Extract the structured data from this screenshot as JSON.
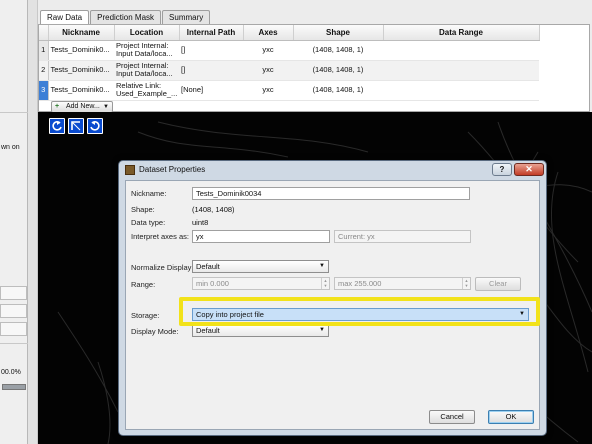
{
  "left_panel": {
    "fragment_text": "wn on",
    "progress_text": "00.0%",
    "progress_fraction": 1.0
  },
  "tabs": [
    {
      "label": "Raw Data",
      "active": true
    },
    {
      "label": "Prediction Mask",
      "active": false
    },
    {
      "label": "Summary",
      "active": false
    }
  ],
  "table": {
    "columns": [
      "",
      "Nickname",
      "Location",
      "Internal Path",
      "Axes",
      "Shape",
      "Data Range"
    ],
    "rows": [
      {
        "num": "1",
        "nickname": "Tests_Dominik0...",
        "location": "Project Internal: Input Data/loca...",
        "internal_path": "[]",
        "axes": "yxc",
        "shape": "(1408, 1408, 1)",
        "data_range": ""
      },
      {
        "num": "2",
        "nickname": "Tests_Dominik0...",
        "location": "Project Internal: Input Data/loca...",
        "internal_path": "[]",
        "axes": "yxc",
        "shape": "(1408, 1408, 1)",
        "data_range": ""
      },
      {
        "num": "3",
        "nickname": "Tests_Dominik0...",
        "location": "Relative Link: Used_Example_...",
        "internal_path": "[None]",
        "axes": "yxc",
        "shape": "(1408, 1408, 1)",
        "data_range": ""
      }
    ],
    "add_new_label": "Add New..."
  },
  "viewer": {
    "tool_icons": [
      "rotate-left-icon",
      "swap-axes-icon",
      "rotate-right-icon"
    ]
  },
  "dialog": {
    "title": "Dataset Properties",
    "help_label": "?",
    "close_label": "✕",
    "nickname_label": "Nickname:",
    "nickname_value": "Tests_Dominik0034",
    "shape_label": "Shape:",
    "shape_value": "(1408, 1408)",
    "dtype_label": "Data type:",
    "dtype_value": "uint8",
    "axes_label": "Interpret axes as:",
    "axes_value": "yx",
    "current_axes": "Current: yx",
    "normalize_label": "Normalize Display:",
    "normalize_value": "Default",
    "range_label": "Range:",
    "range_min": "min 0.000",
    "range_max": "max 255.000",
    "clear_label": "Clear",
    "storage_label": "Storage:",
    "storage_value": "Copy into project file",
    "display_mode_label": "Display Mode:",
    "display_mode_value": "Default",
    "cancel_label": "Cancel",
    "ok_label": "OK"
  },
  "colors": {
    "highlight": "#f2e21a",
    "tool_button": "#0a4bcf",
    "selected_row": "#3d7fd6"
  }
}
